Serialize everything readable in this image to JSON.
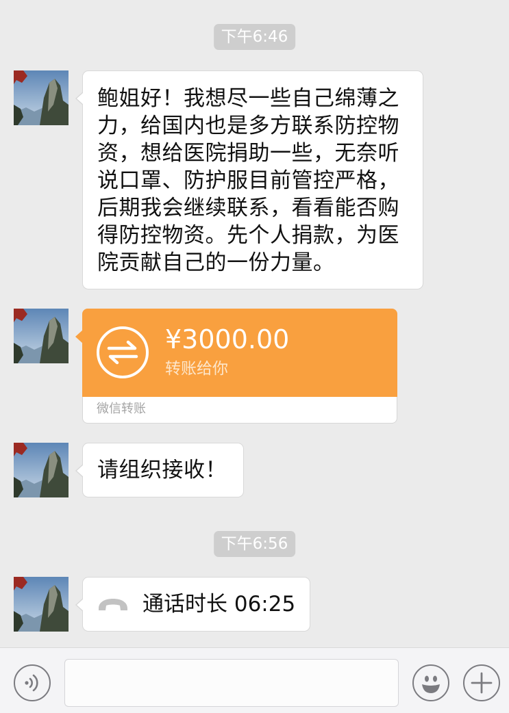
{
  "colors": {
    "chat_background": "#ebebeb",
    "bubble_background": "#ffffff",
    "timestamp_background": "#cecece",
    "transfer_accent": "#f9a03f",
    "input_bar_background": "#f4f4f6"
  },
  "messages": {
    "timestamp_1": "下午6:46",
    "text_1_lines": [
      "鲍姐好！我想尽一些自己绵薄之",
      "力，给国内也是多方联系防控物",
      "资，想给医院捐助一些，无奈听",
      "说口罩、防护服目前管控严格，",
      "后期我会继续联系，看看能否购",
      "得防控物资。先个人捐款，为医",
      "院贡献自己的一份力量。"
    ],
    "transfer": {
      "amount": "¥3000.00",
      "subtitle": "转账给你",
      "footer": "微信转账",
      "icon": "transfer-arrows-icon"
    },
    "text_3": "请组织接收！",
    "timestamp_2": "下午6:56",
    "call": {
      "icon": "phone-hangup-icon",
      "label": "通话时长 06:25"
    }
  },
  "input_bar": {
    "voice_icon": "voice-icon",
    "input_value": "",
    "emoji_icon": "emoji-icon",
    "add_icon": "plus-icon"
  }
}
